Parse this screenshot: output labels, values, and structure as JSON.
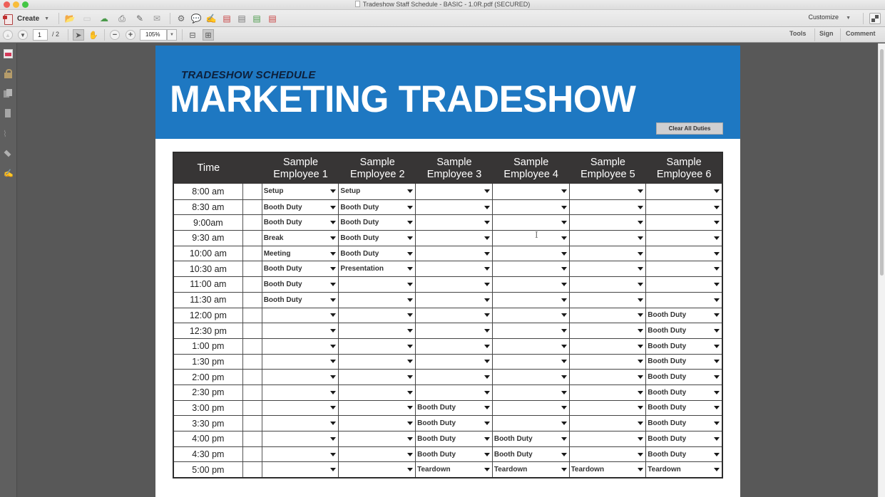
{
  "window": {
    "title": "Tradeshow Staff Schedule - BASIC - 1.0R.pdf (SECURED)"
  },
  "toolbar": {
    "create_label": "Create",
    "customize_label": "Customize",
    "icons": [
      "open-icon",
      "save-icon",
      "cloud-upload-icon",
      "print-icon",
      "edit-icon",
      "email-icon",
      "gear-icon",
      "comment-icon",
      "sign-icon",
      "pdf-remove-icon",
      "pdf-search-icon",
      "pdf-export-icon",
      "pdf-edit-icon"
    ]
  },
  "navbar": {
    "current_page": "1",
    "total_pages": "/ 2",
    "zoom_level": "105%",
    "tools_label": "Tools",
    "sign_label": "Sign",
    "comment_label": "Comment"
  },
  "document": {
    "subtitle": "TRADESHOW SCHEDULE",
    "title": "MARKETING TRADESHOW",
    "clear_button": "Clear All Duties",
    "accent_color": "#1e78c2",
    "header_color": "#373535",
    "table": {
      "time_header": "Time",
      "employees": [
        {
          "line1": "Sample",
          "line2": "Employee 1"
        },
        {
          "line1": "Sample",
          "line2": "Employee 2"
        },
        {
          "line1": "Sample",
          "line2": "Employee 3"
        },
        {
          "line1": "Sample",
          "line2": "Employee 4"
        },
        {
          "line1": "Sample",
          "line2": "Employee 5"
        },
        {
          "line1": "Sample",
          "line2": "Employee 6"
        }
      ],
      "rows": [
        {
          "time": "8:00 am",
          "duties": [
            "Setup",
            "Setup",
            "",
            "",
            "",
            ""
          ]
        },
        {
          "time": "8:30 am",
          "duties": [
            "Booth Duty",
            "Booth Duty",
            "",
            "",
            "",
            ""
          ]
        },
        {
          "time": "9:00am",
          "duties": [
            "Booth Duty",
            "Booth Duty",
            "",
            "",
            "",
            ""
          ]
        },
        {
          "time": "9:30 am",
          "duties": [
            "Break",
            "Booth Duty",
            "",
            "",
            "",
            ""
          ]
        },
        {
          "time": "10:00 am",
          "duties": [
            "Meeting",
            "Booth Duty",
            "",
            "",
            "",
            ""
          ]
        },
        {
          "time": "10:30 am",
          "duties": [
            "Booth Duty",
            "Presentation",
            "",
            "",
            "",
            ""
          ]
        },
        {
          "time": "11:00 am",
          "duties": [
            "Booth Duty",
            "",
            "",
            "",
            "",
            ""
          ]
        },
        {
          "time": "11:30 am",
          "duties": [
            "Booth Duty",
            "",
            "",
            "",
            "",
            ""
          ]
        },
        {
          "time": "12:00 pm",
          "duties": [
            "",
            "",
            "",
            "",
            "",
            "Booth Duty"
          ]
        },
        {
          "time": "12:30 pm",
          "duties": [
            "",
            "",
            "",
            "",
            "",
            "Booth Duty"
          ]
        },
        {
          "time": "1:00 pm",
          "duties": [
            "",
            "",
            "",
            "",
            "",
            "Booth Duty"
          ]
        },
        {
          "time": "1:30 pm",
          "duties": [
            "",
            "",
            "",
            "",
            "",
            "Booth Duty"
          ]
        },
        {
          "time": "2:00 pm",
          "duties": [
            "",
            "",
            "",
            "",
            "",
            "Booth Duty"
          ]
        },
        {
          "time": "2:30 pm",
          "duties": [
            "",
            "",
            "",
            "",
            "",
            "Booth Duty"
          ]
        },
        {
          "time": "3:00 pm",
          "duties": [
            "",
            "",
            "Booth Duty",
            "",
            "",
            "Booth Duty"
          ]
        },
        {
          "time": "3:30 pm",
          "duties": [
            "",
            "",
            "Booth Duty",
            "",
            "",
            "Booth Duty"
          ]
        },
        {
          "time": "4:00 pm",
          "duties": [
            "",
            "",
            "Booth Duty",
            "Booth Duty",
            "",
            "Booth Duty"
          ]
        },
        {
          "time": "4:30 pm",
          "duties": [
            "",
            "",
            "Booth Duty",
            "Booth Duty",
            "",
            "Booth Duty"
          ]
        },
        {
          "time": "5:00 pm",
          "duties": [
            "",
            "",
            "Teardown",
            "Teardown",
            "Teardown",
            "Teardown"
          ]
        }
      ]
    }
  }
}
